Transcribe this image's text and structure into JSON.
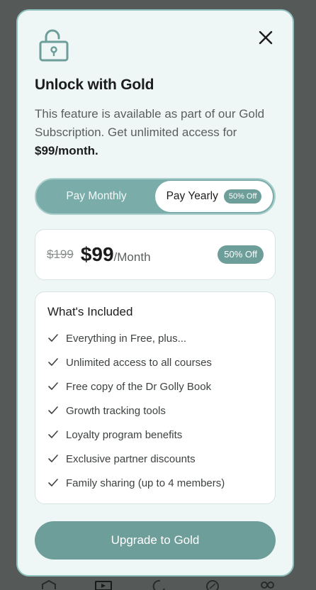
{
  "modal": {
    "title": "Unlock with Gold",
    "description": "This feature is available as part of our Gold Subscription. Get unlimited access for",
    "description_price": "$99/month.",
    "close_icon": "close-icon",
    "lock_icon": "unlock-icon"
  },
  "toggle": {
    "monthly_label": "Pay Monthly",
    "yearly_label": "Pay Yearly",
    "yearly_badge": "50% Off",
    "selected": "yearly"
  },
  "price": {
    "old": "$199",
    "new": "$99",
    "period": "/Month",
    "badge": "50% Off"
  },
  "included": {
    "title": "What's Included",
    "items": [
      "Everything in Free, plus...",
      "Unlimited access to all courses",
      "Free copy of the Dr Golly Book",
      "Growth tracking tools",
      "Loyalty program benefits",
      "Exclusive partner discounts",
      "Family sharing (up to 4 members)"
    ]
  },
  "cta": {
    "label": "Upgrade to Gold"
  },
  "colors": {
    "accent": "#6d9e9a",
    "modal_bg": "#eef7f6"
  }
}
